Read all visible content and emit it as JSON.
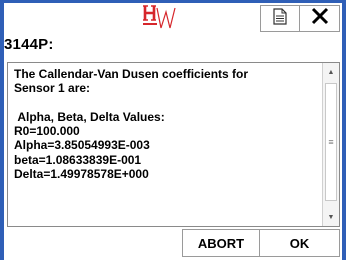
{
  "header": {
    "logo_icon": "hw-logo-icon",
    "document_button_icon": "document-icon",
    "close_button_icon": "close-x-icon"
  },
  "dialog": {
    "title": "3144P:",
    "message": "The Callendar-Van Dusen coefficients for\nSensor 1 are:\n\n Alpha, Beta, Delta Values:\nR0=100.000\nAlpha=3.85054993E-003\nbeta=1.08633839E-001\nDelta=1.49978578E+000"
  },
  "buttons": {
    "abort_label": "ABORT",
    "ok_label": "OK"
  },
  "colors": {
    "frame_blue": "#2f5fb7",
    "logo_red": "#d6262b"
  }
}
